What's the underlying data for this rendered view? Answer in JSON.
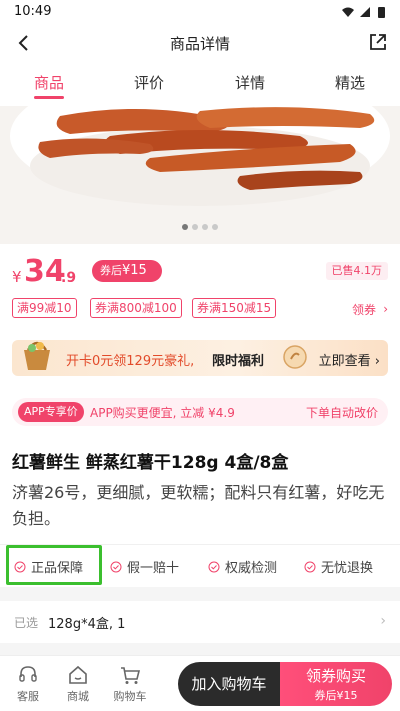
{
  "status_bar": {
    "time": "10:49"
  },
  "nav": {
    "title": "商品详情",
    "back_icon": "back-arrow-icon",
    "share_icon": "share-icon"
  },
  "tabs": [
    {
      "label": "商品",
      "active": true
    },
    {
      "label": "评价",
      "active": false
    },
    {
      "label": "详情",
      "active": false
    },
    {
      "label": "精选",
      "active": false
    }
  ],
  "gallery": {
    "slide_count": 4,
    "active_slide": 1
  },
  "price": {
    "symbol": "¥",
    "integer": "34",
    "decimal": ".9",
    "coupon_label": "券后",
    "coupon_value": "¥15",
    "sold": "已售4.1万"
  },
  "coupons": [
    "满99减10",
    "券满800减100",
    "券满150减15"
  ],
  "get_coupon": "领券",
  "member_banner": {
    "text": "开卡0元领129元豪礼,",
    "highlight": "限时福利",
    "action": "立即查看"
  },
  "app_promo": {
    "badge": "APP专享价",
    "text": "APP购买更便宜, 立减 ¥4.9",
    "right": "下单自动改价"
  },
  "product": {
    "title": "红薯鲜生 鲜蒸红薯干128g 4盒/8盒",
    "description": "济薯26号，更细腻，更软糯；配料只有红薯，好吃无负担。"
  },
  "guarantees": [
    "正品保障",
    "假一赔十",
    "权威检测",
    "无忧退换"
  ],
  "selection": {
    "label": "已选",
    "value": "128g*4盒, 1"
  },
  "bottom_bar": {
    "items": [
      {
        "label": "客服",
        "icon": "headset-icon"
      },
      {
        "label": "商城",
        "icon": "home-icon"
      },
      {
        "label": "购物车",
        "icon": "cart-icon"
      }
    ],
    "add_cart": "加入购物车",
    "buy_label": "领券购买",
    "buy_sub": "券后¥15"
  },
  "colors": {
    "accent": "#f0436a",
    "highlight_box": "#3bbf2e",
    "dark_button": "#2b2b2b"
  }
}
